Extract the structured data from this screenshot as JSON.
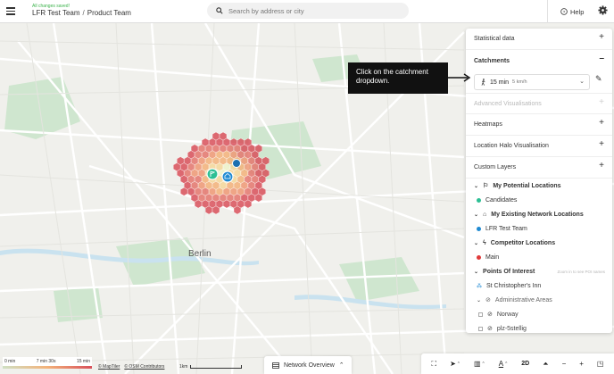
{
  "header": {
    "save_status": "All changes saved!",
    "team": "LFR Test Team",
    "separator": "/",
    "project": "Product Team",
    "search_placeholder": "Search by address or city",
    "help_label": "Help"
  },
  "map": {
    "city_label": "Berlin",
    "pin_colors": {
      "candidate": "#2dbf94",
      "existing": "#1f8ad2",
      "competitor": "#1e6fb0"
    }
  },
  "callout": {
    "text": "Click on the catchment dropdown."
  },
  "panel": {
    "statistical_data": "Statistical data",
    "catchments": "Catchments",
    "catchment_value": "15 min",
    "catchment_mode": "5 km/h",
    "advanced_vis": "Advanced Visualisations",
    "heatmaps": "Heatmaps",
    "location_halo": "Location Halo Visualisation",
    "custom_layers": "Custom Layers",
    "groups": [
      {
        "label": "My Potential Locations",
        "item": "Candidates",
        "color": "#2dbf94"
      },
      {
        "label": "My Existing Network Locations",
        "item": "LFR Test Team",
        "color": "#1f8ad2"
      },
      {
        "label": "Competitor Locations",
        "item": "Main",
        "color": "#e03a3a"
      }
    ],
    "poi_label": "Points Of Interest",
    "poi_hint": "Zoom in to see POI names",
    "poi_item": "St Christopher's Inn",
    "admin_areas": "Administrative Areas",
    "admin_items": [
      "Norway",
      "plz-5stellig"
    ]
  },
  "legend": {
    "labels": [
      "0 min",
      "7 min 30s",
      "15 min"
    ]
  },
  "attribution": {
    "maptiler": "© MapTiler",
    "osm": "© OSM Contributors",
    "scale": "1km"
  },
  "network_overview": "Network Overview",
  "toolbar": {
    "mode_label": "2D"
  }
}
